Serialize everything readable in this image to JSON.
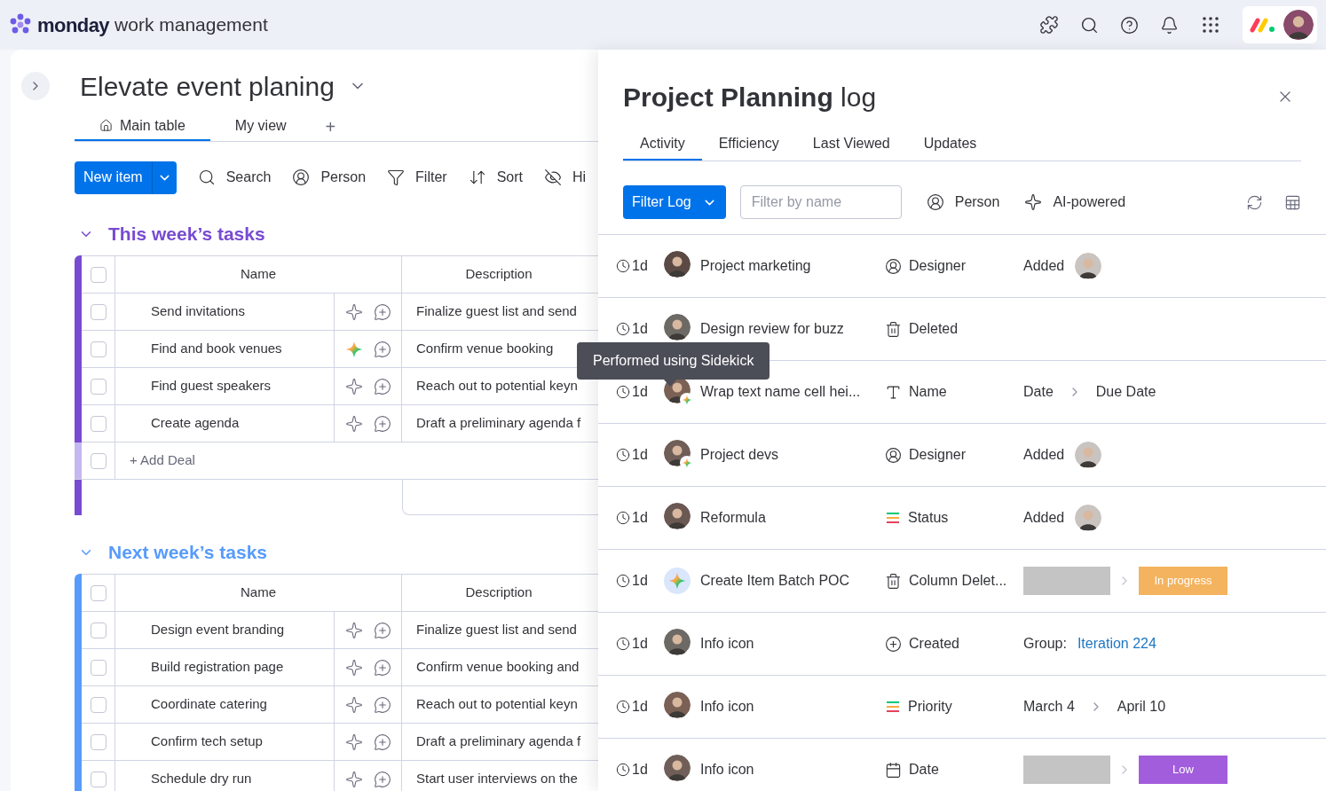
{
  "topbar": {
    "brand": "monday",
    "product": "work management"
  },
  "board": {
    "title": "Elevate event planing",
    "views": [
      {
        "label": "Main table",
        "selected": true,
        "kind": "home"
      },
      {
        "label": "My view",
        "selected": false,
        "kind": "plain"
      }
    ],
    "add_view": "+",
    "toolbar": {
      "new_item": "New item",
      "tools": [
        {
          "kind": "search",
          "label": "Search"
        },
        {
          "kind": "person",
          "label": "Person"
        },
        {
          "kind": "filter",
          "label": "Filter"
        },
        {
          "kind": "sort",
          "label": "Sort"
        },
        {
          "kind": "hide",
          "label": "Hi"
        }
      ]
    },
    "groups": [
      {
        "title": "This week’s tasks",
        "color": "#784bd1",
        "columns": [
          "Name",
          "Description"
        ],
        "all_checked": false,
        "add_row_checked": false,
        "rows": [
          {
            "name": "Send invitations",
            "checked": false,
            "ai_active": false,
            "description": "Finalize guest list and send"
          },
          {
            "name": "Find and book venues",
            "checked": false,
            "ai_active": true,
            "description": "Confirm venue booking"
          },
          {
            "name": "Find guest speakers",
            "checked": false,
            "ai_active": false,
            "description": "Reach out to potential keyn"
          },
          {
            "name": "Create agenda",
            "checked": false,
            "ai_active": false,
            "description": "Draft a preliminary agenda f"
          }
        ],
        "add_row": "+ Add Deal"
      },
      {
        "title": "Next week’s tasks",
        "color": "#579bfc",
        "columns": [
          "Name",
          "Description"
        ],
        "all_checked": false,
        "rows": [
          {
            "name": "Design event branding",
            "checked": false,
            "ai_active": false,
            "description": "Finalize guest list and send"
          },
          {
            "name": "Build registration page",
            "checked": false,
            "ai_active": false,
            "description": "Confirm venue booking and"
          },
          {
            "name": "Coordinate catering",
            "checked": false,
            "ai_active": false,
            "description": "Reach out to potential keyn"
          },
          {
            "name": "Confirm tech setup",
            "checked": false,
            "ai_active": false,
            "description": "Draft a preliminary agenda f"
          },
          {
            "name": "Schedule dry run",
            "checked": false,
            "ai_active": false,
            "description": "Start user interviews on the"
          }
        ]
      }
    ]
  },
  "log_panel": {
    "title": "Project Planning",
    "title_suffix": "log",
    "tabs": [
      {
        "label": "Activity",
        "selected": true
      },
      {
        "label": "Efficiency",
        "selected": false
      },
      {
        "label": "Last Viewed",
        "selected": false
      },
      {
        "label": "Updates",
        "selected": false
      }
    ],
    "filter_button": "Filter Log",
    "filter_field": {
      "placeholder": "Filter by name"
    },
    "tools": [
      {
        "kind": "person",
        "label": "Person"
      },
      {
        "kind": "ai",
        "label": "AI-powered"
      }
    ],
    "tooltip": "Performed using Sidekick",
    "entries": [
      {
        "time": "1d",
        "actor": {
          "kind": "person",
          "ai_badge": false
        },
        "item": "Project marketing",
        "field": {
          "kind": "people",
          "label": "Designer"
        },
        "value": {
          "kind": "added",
          "label": "Added"
        }
      },
      {
        "time": "1d",
        "actor": {
          "kind": "person",
          "ai_badge": false
        },
        "item": "Design review for buzz",
        "field": {
          "kind": "trash",
          "label": "Deleted"
        }
      },
      {
        "time": "1d",
        "actor": {
          "kind": "person",
          "ai_badge": true
        },
        "item": "Wrap text name cell hei...",
        "field": {
          "kind": "text",
          "label": "Name"
        },
        "value": {
          "kind": "change",
          "from": "Date",
          "to": "Due Date"
        }
      },
      {
        "time": "1d",
        "actor": {
          "kind": "person",
          "ai_badge": true
        },
        "item": "Project devs",
        "field": {
          "kind": "people",
          "label": "Designer"
        },
        "value": {
          "kind": "added",
          "label": "Added"
        }
      },
      {
        "time": "1d",
        "actor": {
          "kind": "person",
          "ai_badge": false
        },
        "item": "Reformula",
        "field": {
          "kind": "status",
          "label": "Status"
        },
        "value": {
          "kind": "added",
          "label": "Added"
        }
      },
      {
        "time": "1d",
        "actor": {
          "kind": "ai"
        },
        "item": "Create Item Batch POC",
        "field": {
          "kind": "trash",
          "label": "Column Delet..."
        },
        "value": {
          "kind": "label_change",
          "to": "In progress",
          "color": "#f4b35e"
        }
      },
      {
        "time": "1d",
        "actor": {
          "kind": "person",
          "ai_badge": false
        },
        "item": "Info icon",
        "field": {
          "kind": "created",
          "label": "Created"
        },
        "value": {
          "kind": "group",
          "label": "Group:",
          "link": "Iteration 224"
        }
      },
      {
        "time": "1d",
        "actor": {
          "kind": "person",
          "ai_badge": false
        },
        "item": "Info icon",
        "field": {
          "kind": "status",
          "label": "Priority"
        },
        "value": {
          "kind": "change",
          "from": "March 4",
          "to": "April 10"
        }
      },
      {
        "time": "1d",
        "actor": {
          "kind": "person",
          "ai_badge": false
        },
        "item": "Info icon",
        "field": {
          "kind": "date",
          "label": "Date"
        },
        "value": {
          "kind": "label_change",
          "to": "Low",
          "color": "#a25ddc"
        }
      }
    ]
  }
}
